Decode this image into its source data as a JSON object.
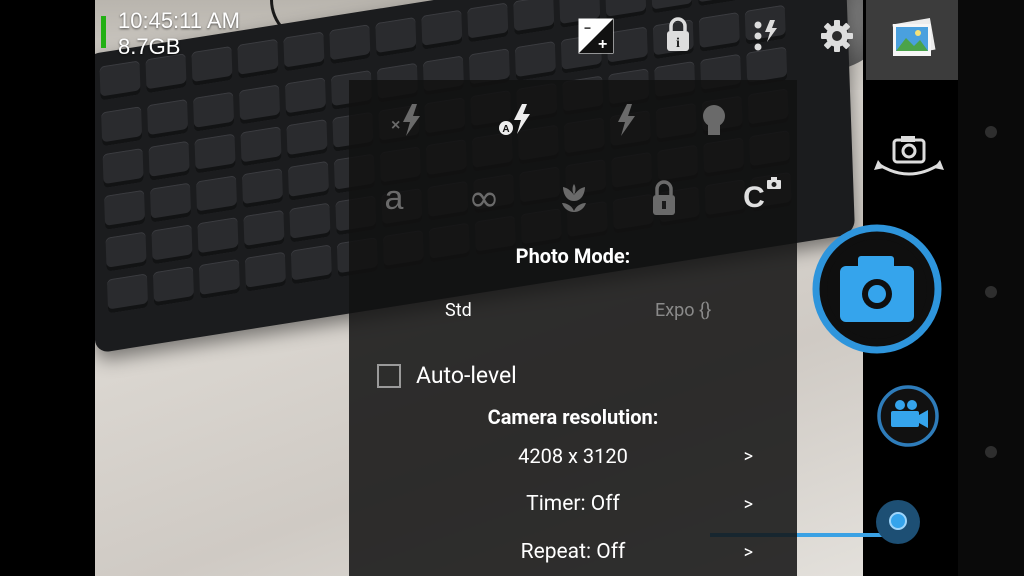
{
  "status": {
    "time": "10:45:11 AM",
    "storage": "8.7GB"
  },
  "top_toolbar": {
    "icons": [
      "exposure-icon",
      "info-lock-icon",
      "popup-menu-icon",
      "settings-icon",
      "gallery-icon"
    ]
  },
  "popup": {
    "flash_icons": [
      "flash-off-icon",
      "flash-auto-icon",
      "flash-on-icon",
      "torch-icon"
    ],
    "focus_labels": {
      "auto": "a",
      "infinity": "∞",
      "lock": "",
      "continuous": "C"
    },
    "photo_mode_title": "Photo Mode:",
    "modes": {
      "std": "Std",
      "expo": "Expo {}"
    },
    "auto_level_label": "Auto-level",
    "resolution_title": "Camera resolution:",
    "resolution_value": "4208 x 3120",
    "timer_label": "Timer: Off",
    "repeat_label": "Repeat: Off",
    "chevron": ">"
  },
  "colors": {
    "accent": "#3aa1e4",
    "battery": "#22b014",
    "popup_bg": "#121212"
  },
  "zoom_level": 1.0
}
